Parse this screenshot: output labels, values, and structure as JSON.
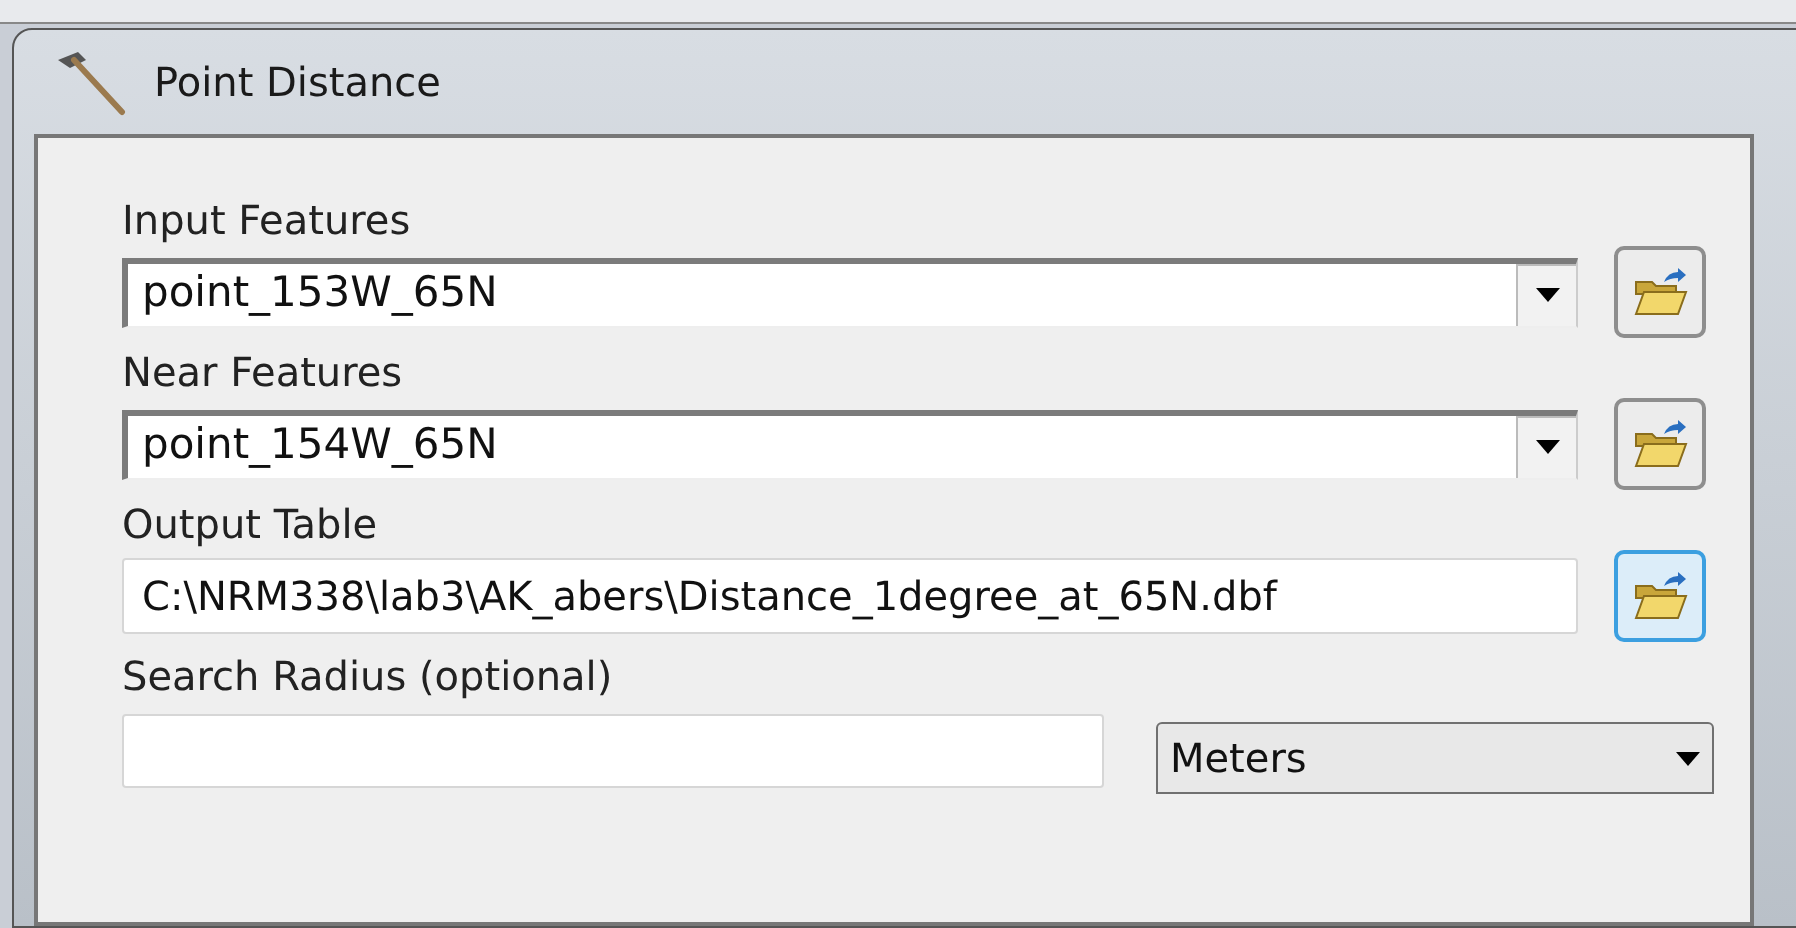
{
  "window": {
    "title": "Point Distance"
  },
  "parameters": [
    {
      "label": "Input Features",
      "kind": "combo",
      "value": "point_153W_65N",
      "browse_highlighted": false
    },
    {
      "label": "Near Features",
      "kind": "combo",
      "value": "point_154W_65N",
      "browse_highlighted": false
    },
    {
      "label": "Output Table",
      "kind": "path",
      "value": "C:\\NRM338\\lab3\\AK_abers\\Distance_1degree_at_65N.dbf",
      "browse_highlighted": true
    },
    {
      "label": "Search Radius (optional)",
      "kind": "units",
      "units": "Meters"
    }
  ]
}
